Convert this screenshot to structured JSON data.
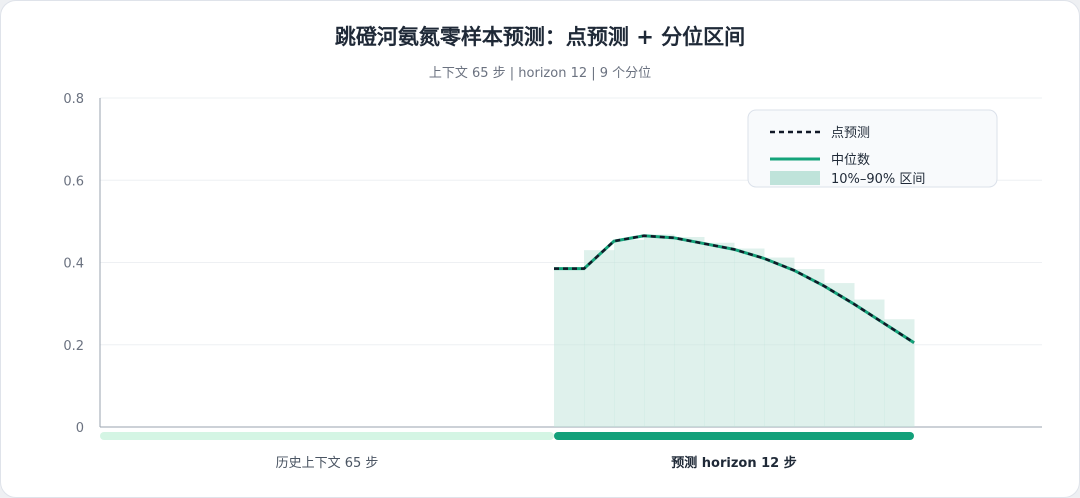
{
  "chart_data": {
    "type": "line",
    "title": "跳磴河氨氮零样本预测：点预测 + 分位区间",
    "subtitle": "上下文 65 步 | horizon 12 | 9 个分位",
    "ylim": [
      0,
      0.8
    ],
    "yticks": [
      "0",
      "0.2",
      "0.4",
      "0.6",
      "0.8"
    ],
    "grid": true,
    "legend_position": "top-right",
    "context_steps": 65,
    "horizon": 12,
    "series": [
      {
        "name": "点预测",
        "style": "dashed",
        "color": "#111827",
        "values": [
          0.385,
          0.385,
          0.452,
          0.465,
          0.46,
          0.446,
          0.432,
          0.41,
          0.381,
          0.343,
          0.299,
          0.252,
          0.205
        ]
      },
      {
        "name": "中位数",
        "style": "solid",
        "color": "#14a37a",
        "values": [
          0.385,
          0.385,
          0.452,
          0.465,
          0.46,
          0.446,
          0.432,
          0.41,
          0.381,
          0.343,
          0.299,
          0.252,
          0.205
        ]
      }
    ],
    "band": {
      "name": "10%–90% 区间",
      "color": "#bfe3da",
      "lower": [
        0,
        0,
        0,
        0,
        0,
        0,
        0,
        0,
        0,
        0,
        0,
        0,
        0
      ],
      "upper": [
        0.385,
        0.43,
        0.455,
        0.468,
        0.462,
        0.448,
        0.434,
        0.412,
        0.384,
        0.35,
        0.31,
        0.262,
        0.21
      ]
    },
    "segments": [
      {
        "label": "历史上下文 65 步",
        "color": "#d4f5e4"
      },
      {
        "label": "预测 horizon 12 步",
        "color": "#12a07a"
      }
    ]
  }
}
